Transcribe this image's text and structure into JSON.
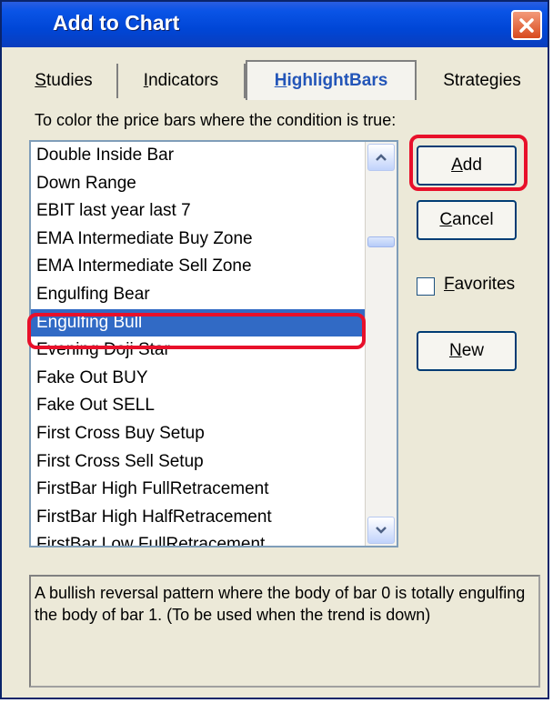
{
  "window": {
    "title": "Add to Chart"
  },
  "tabs": [
    {
      "label": "Studies",
      "accel": "S",
      "rest": "tudies"
    },
    {
      "label": "Indicators",
      "accel": "I",
      "rest": "ndicators"
    },
    {
      "label": "HighlightBars",
      "accel": "H",
      "rest": "ighlightBars"
    },
    {
      "label": "Strategies",
      "accel": "",
      "rest": "Strategies"
    }
  ],
  "instruction": "To color the price bars where the condition is true:",
  "list": {
    "items": [
      "Double Inside Bar",
      "Down Range",
      "EBIT last year last 7",
      "EMA Intermediate Buy Zone",
      "EMA Intermediate Sell Zone",
      "Engulfing Bear",
      "Engulfing Bull",
      "Evening Doji Star",
      "Fake Out BUY",
      "Fake Out SELL",
      "First Cross Buy Setup",
      "First Cross Sell Setup",
      "FirstBar High FullRetracement",
      "FirstBar High HalfRetracement",
      "FirstBar Low FullRetracement"
    ],
    "selected_item": "Engulfing Bull"
  },
  "buttons": {
    "add": {
      "label": "Add",
      "accel": "A",
      "rest": "dd"
    },
    "cancel": {
      "label": "Cancel",
      "accel": "C",
      "rest": "ancel"
    },
    "new": {
      "label": "New",
      "accel": "N",
      "rest": "ew"
    }
  },
  "favorites": {
    "label": "Favorites",
    "accel": "F",
    "rest": "avorites",
    "checked": false
  },
  "description": "A bullish reversal pattern where the body of bar 0 is totally engulfing the body of bar 1. (To be used when the trend is down)",
  "colors": {
    "titlebar": "#0a54e6",
    "selection": "#316ac5",
    "highlight": "#e8102a",
    "dialog_bg": "#ece9d8"
  },
  "icons": {
    "close": "close-icon",
    "scroll_up": "chevron-up-icon",
    "scroll_down": "chevron-down-icon"
  }
}
